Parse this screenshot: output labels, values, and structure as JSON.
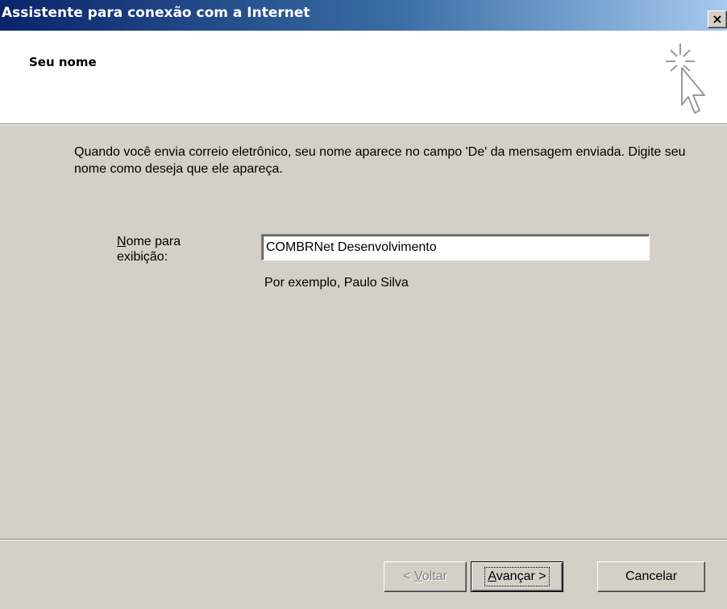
{
  "window": {
    "title": "Assistente para conexão com a Internet",
    "close_label": "×"
  },
  "header": {
    "title": "Seu nome",
    "icon": "wizard-cursor-icon"
  },
  "body": {
    "description": "Quando você envia correio eletrônico, seu nome aparece no campo 'De' da mensagem enviada. Digite seu nome como deseja que ele apareça.",
    "field": {
      "label_mnemonic": "N",
      "label_rest": "ome para exibição:",
      "value": "COMBRNet Desenvolvimento",
      "hint": "Por exemplo, Paulo Silva"
    }
  },
  "buttons": {
    "back": {
      "prefix": "< ",
      "mnemonic": "V",
      "rest": "oltar",
      "enabled": false
    },
    "next": {
      "mnemonic": "A",
      "rest": "vançar >",
      "enabled": true
    },
    "cancel": {
      "label": "Cancelar",
      "enabled": true
    }
  },
  "colors": {
    "dialog_bg": "#d4d0c8",
    "titlebar_start": "#0a246a",
    "titlebar_end": "#a6caf0"
  }
}
